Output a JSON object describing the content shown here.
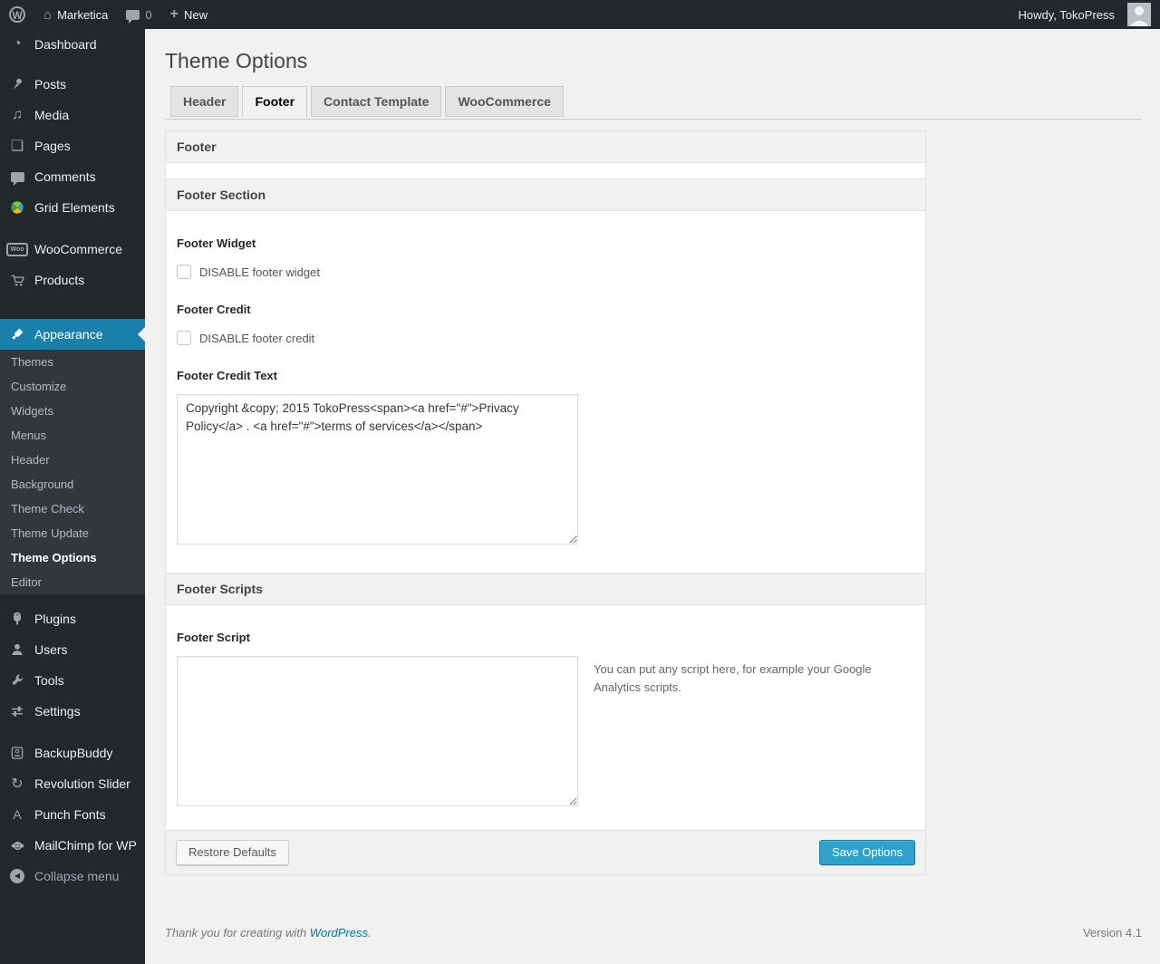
{
  "admin_bar": {
    "wp_logo": "W",
    "site_name": "Marketica",
    "comment_count": "0",
    "new_label": "New",
    "howdy": "Howdy, TokoPress"
  },
  "sidebar": {
    "items": [
      {
        "label": "Dashboard"
      },
      {
        "label": "Posts"
      },
      {
        "label": "Media"
      },
      {
        "label": "Pages"
      },
      {
        "label": "Comments"
      },
      {
        "label": "Grid Elements"
      },
      {
        "label": "WooCommerce"
      },
      {
        "label": "Products"
      },
      {
        "label": "Appearance"
      },
      {
        "label": "Plugins"
      },
      {
        "label": "Users"
      },
      {
        "label": "Tools"
      },
      {
        "label": "Settings"
      },
      {
        "label": "BackupBuddy"
      },
      {
        "label": "Revolution Slider"
      },
      {
        "label": "Punch Fonts"
      },
      {
        "label": "MailChimp for WP"
      }
    ],
    "appearance_submenu": [
      "Themes",
      "Customize",
      "Widgets",
      "Menus",
      "Header",
      "Background",
      "Theme Check",
      "Theme Update",
      "Theme Options",
      "Editor"
    ],
    "current_submenu_item": "Theme Options",
    "woo_badge": "Woo",
    "punch_fonts_glyph": "A",
    "collapse_label": "Collapse menu"
  },
  "main": {
    "title": "Theme Options",
    "tabs": [
      "Header",
      "Footer",
      "Contact Template",
      "WooCommerce"
    ],
    "active_tab": "Footer",
    "box_title": "Footer",
    "footer_section": {
      "title": "Footer Section",
      "footer_widget_label": "Footer Widget",
      "footer_widget_checkbox_label": "DISABLE footer widget",
      "footer_credit_label": "Footer Credit",
      "footer_credit_checkbox_label": "DISABLE footer credit",
      "footer_credit_text_label": "Footer Credit Text",
      "footer_credit_text_value": "Copyright &copy; 2015 TokoPress<span><a href=\"#\">Privacy Policy</a> . <a href=\"#\">terms of services</a></span>"
    },
    "footer_scripts": {
      "title": "Footer Scripts",
      "footer_script_label": "Footer Script",
      "footer_script_value": "",
      "help_text": "You can put any script here, for example your Google Analytics scripts."
    },
    "actions": {
      "restore_label": "Restore Defaults",
      "save_label": "Save Options"
    }
  },
  "colophon": {
    "thanks_text": "Thank you for creating with ",
    "wordpress_link": "WordPress",
    "period": ".",
    "version": "Version 4.1"
  },
  "colors": {
    "menu_highlight": "#1b7fab",
    "primary_button": "#2ea2cc",
    "link": "#0074a2"
  }
}
